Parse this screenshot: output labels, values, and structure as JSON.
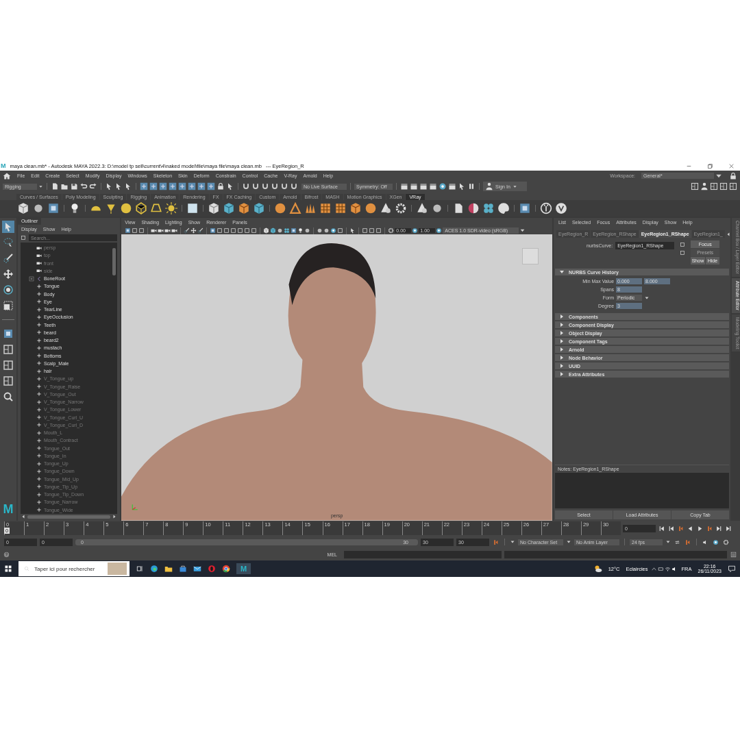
{
  "title_bar": {
    "app_icon": "M",
    "title": "maya clean.mb* - Autodesk MAYA 2022.3: D:\\model tp sell\\current\\4\\naked model\\file\\maya file\\maya clean.mb",
    "node": "---  EyeRegion_R"
  },
  "menu_bar": {
    "items": [
      "File",
      "Edit",
      "Create",
      "Select",
      "Modify",
      "Display",
      "Windows",
      "Skeleton",
      "Skin",
      "Deform",
      "Constrain",
      "Control",
      "Cache",
      "V-Ray",
      "Arnold",
      "Help"
    ],
    "workspace_label": "Workspace:",
    "workspace": "General*"
  },
  "status_line": {
    "menu_set": "Rigging",
    "live_surface": "No Live Surface",
    "symmetry": "Symmetry: Off",
    "sign_in": "Sign In"
  },
  "shelf_tabs": [
    {
      "label": "Curves / Surfaces",
      "selected": false
    },
    {
      "label": "Poly Modeling",
      "selected": false
    },
    {
      "label": "Sculpting",
      "selected": false
    },
    {
      "label": "Rigging",
      "selected": false
    },
    {
      "label": "Animation",
      "selected": false
    },
    {
      "label": "Rendering",
      "selected": false
    },
    {
      "label": "FX",
      "selected": false
    },
    {
      "label": "FX Caching",
      "selected": false
    },
    {
      "label": "Custom",
      "selected": false
    },
    {
      "label": "Arnold",
      "selected": false
    },
    {
      "label": "Bifrost",
      "selected": false
    },
    {
      "label": "MASH",
      "selected": false
    },
    {
      "label": "Motion Graphics",
      "selected": false
    },
    {
      "label": "XGen",
      "selected": false
    },
    {
      "label": "VRay",
      "selected": true
    }
  ],
  "outliner": {
    "title": "Outliner",
    "menu": [
      "Display",
      "Show",
      "Help"
    ],
    "search": {
      "placeholder": "Search..."
    },
    "items": [
      {
        "label": "persp",
        "kind": "camera",
        "hidden": true
      },
      {
        "label": "top",
        "kind": "camera",
        "hidden": true
      },
      {
        "label": "front",
        "kind": "camera",
        "hidden": true
      },
      {
        "label": "side",
        "kind": "camera",
        "hidden": true
      },
      {
        "label": "BoneRoot",
        "kind": "joint",
        "hidden": false,
        "expanded": false
      },
      {
        "label": "Tongue",
        "kind": "mesh",
        "hidden": false
      },
      {
        "label": "Body",
        "kind": "mesh",
        "hidden": false
      },
      {
        "label": "Eye",
        "kind": "mesh",
        "hidden": false
      },
      {
        "label": "TearLine",
        "kind": "mesh",
        "hidden": false
      },
      {
        "label": "EyeOcclusion",
        "kind": "mesh",
        "hidden": false
      },
      {
        "label": "Teeth",
        "kind": "mesh",
        "hidden": false
      },
      {
        "label": "beard",
        "kind": "mesh",
        "hidden": false
      },
      {
        "label": "beard2",
        "kind": "mesh",
        "hidden": false
      },
      {
        "label": "mustach",
        "kind": "mesh",
        "hidden": false
      },
      {
        "label": "Bottoms",
        "kind": "mesh",
        "hidden": false
      },
      {
        "label": "Scalp_Male",
        "kind": "mesh",
        "hidden": false
      },
      {
        "label": "hair",
        "kind": "mesh",
        "hidden": false
      },
      {
        "label": "V_Tongue_up",
        "kind": "mesh",
        "hidden": true
      },
      {
        "label": "V_Tongue_Raise",
        "kind": "mesh",
        "hidden": true
      },
      {
        "label": "V_Tongue_Out",
        "kind": "mesh",
        "hidden": true
      },
      {
        "label": "V_Tongue_Narrow",
        "kind": "mesh",
        "hidden": true
      },
      {
        "label": "V_Tongue_Lower",
        "kind": "mesh",
        "hidden": true
      },
      {
        "label": "V_Tongue_Curl_U",
        "kind": "mesh",
        "hidden": true
      },
      {
        "label": "V_Tongue_Curl_D",
        "kind": "mesh",
        "hidden": true
      },
      {
        "label": "Mouth_L",
        "kind": "mesh",
        "hidden": true
      },
      {
        "label": "Mouth_Contract",
        "kind": "mesh",
        "hidden": true
      },
      {
        "label": "Tongue_Out",
        "kind": "mesh",
        "hidden": true
      },
      {
        "label": "Tongue_In",
        "kind": "mesh",
        "hidden": true
      },
      {
        "label": "Tongue_Up",
        "kind": "mesh",
        "hidden": true
      },
      {
        "label": "Tongue_Down",
        "kind": "mesh",
        "hidden": true
      },
      {
        "label": "Tongue_Mid_Up",
        "kind": "mesh",
        "hidden": true
      },
      {
        "label": "Tongue_Tip_Up",
        "kind": "mesh",
        "hidden": true
      },
      {
        "label": "Tongue_Tip_Down",
        "kind": "mesh",
        "hidden": true
      },
      {
        "label": "Tongue_Narrow",
        "kind": "mesh",
        "hidden": true
      },
      {
        "label": "Tongue_Wide",
        "kind": "mesh",
        "hidden": true
      }
    ]
  },
  "toolbox": {
    "logo": "M"
  },
  "viewport": {
    "menu": [
      "View",
      "Shading",
      "Lighting",
      "Show",
      "Renderer",
      "Panels"
    ],
    "exposure": "0.00",
    "gamma": "1.00",
    "color_space": "ACES 1.0 SDR-video (sRGB)",
    "camera": "persp"
  },
  "attribute_editor": {
    "menu": [
      "List",
      "Selected",
      "Focus",
      "Attributes",
      "Display",
      "Show",
      "Help"
    ],
    "tabs": [
      {
        "label": "EyeRegion_R",
        "selected": false
      },
      {
        "label": "EyeRegion_RShape",
        "selected": false
      },
      {
        "label": "EyeRegion1_RShape",
        "selected": true
      },
      {
        "label": "EyeRegion1_",
        "selected": false
      }
    ],
    "node_label": "nurbsCurve:",
    "node_name": "EyeRegion1_RShape",
    "side_buttons": [
      {
        "label": "Focus",
        "disabled": false
      },
      {
        "label": "Presets",
        "disabled": true
      }
    ],
    "show_hide": [
      "Show",
      "Hide"
    ],
    "sections": [
      {
        "title": "NURBS Curve History",
        "expanded": true,
        "fields": [
          {
            "label": "Min Max Value",
            "kind": "pair",
            "values": [
              "0.000",
              "8.000"
            ]
          },
          {
            "label": "Spans",
            "kind": "number",
            "values": [
              "8"
            ]
          },
          {
            "label": "Form",
            "kind": "dropdown",
            "values": [
              "Periodic"
            ]
          },
          {
            "label": "Degree",
            "kind": "number",
            "values": [
              "3"
            ]
          }
        ]
      },
      {
        "title": "Components",
        "expanded": false
      },
      {
        "title": "Component Display",
        "expanded": false
      },
      {
        "title": "Object Display",
        "expanded": false
      },
      {
        "title": "Component Tags",
        "expanded": false
      },
      {
        "title": "Arnold",
        "expanded": false
      },
      {
        "title": "Node Behavior",
        "expanded": false
      },
      {
        "title": "UUID",
        "expanded": false
      },
      {
        "title": "Extra Attributes",
        "expanded": false
      }
    ],
    "notes_label": "Notes:  EyeRegion1_RShape",
    "buttons": [
      "Select",
      "Load Attributes",
      "Copy Tab"
    ]
  },
  "side_tabs": [
    {
      "label": "Channel Box / Layer Editor",
      "selected": false
    },
    {
      "label": "Attribute Editor",
      "selected": true
    },
    {
      "label": "Modeling Toolkit",
      "selected": false
    }
  ],
  "time_slider": {
    "ticks": [
      "0",
      "1",
      "2",
      "3",
      "4",
      "5",
      "6",
      "7",
      "8",
      "9",
      "10",
      "11",
      "12",
      "13",
      "14",
      "15",
      "16",
      "17",
      "18",
      "19",
      "20",
      "21",
      "22",
      "23",
      "24",
      "25",
      "26",
      "27",
      "28",
      "29",
      "30"
    ],
    "current_frame": "0",
    "frame_field": "0",
    "level": 0
  },
  "range_slider": {
    "start": "0",
    "playback_start": "0",
    "bar_start": "0",
    "bar_end": "30",
    "playback_end": "30",
    "end": "30",
    "character_set": "No Character Set",
    "anim_layer": "No Anim Layer",
    "fps": "24 fps",
    "level": 1
  },
  "command_line": {
    "language": "MEL"
  },
  "taskbar": {
    "app_button": "M",
    "search": {
      "placeholder": "Taper ici pour rechercher"
    },
    "temperature": "12°C",
    "weather": "Eclaircies",
    "language": "FRA",
    "time": "22:16",
    "date": "26/11/2023"
  }
}
